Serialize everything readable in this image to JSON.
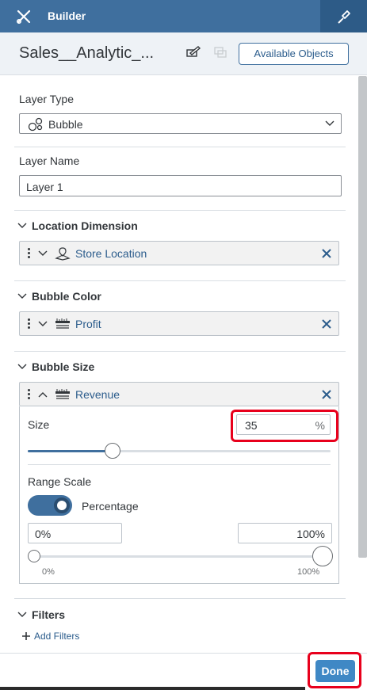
{
  "topbar": {
    "title": "Builder"
  },
  "header": {
    "model_name": "Sales__Analytic_...",
    "available_objects_label": "Available Objects"
  },
  "layer_type": {
    "label": "Layer Type",
    "value": "Bubble"
  },
  "layer_name": {
    "label": "Layer Name",
    "value": "Layer 1"
  },
  "location_dimension": {
    "title": "Location Dimension",
    "token": "Store Location"
  },
  "bubble_color": {
    "title": "Bubble Color",
    "token": "Profit"
  },
  "bubble_size": {
    "title": "Bubble Size",
    "token": "Revenue",
    "size_label": "Size",
    "size_value": "35",
    "size_unit": "%",
    "size_slider_fraction": 0.28,
    "range_scale_label": "Range Scale",
    "toggle_label": "Percentage",
    "toggle_on": true,
    "range_min": "0%",
    "range_max": "100%",
    "range_min_tick": "0%",
    "range_max_tick": "100%"
  },
  "filters": {
    "title": "Filters",
    "add_label": "Add Filters"
  },
  "footer": {
    "done_label": "Done"
  },
  "colors": {
    "accent": "#3f6f9e",
    "highlight": "#e8001c",
    "token_text": "#2b5c8c"
  },
  "icons": [
    "tools-icon",
    "paint-brush-icon",
    "edit-icon",
    "copy-icon",
    "bubble-icon",
    "location-pin-icon",
    "measure-icon",
    "chevron-down-icon",
    "chevron-up-icon",
    "close-icon",
    "plus-icon"
  ]
}
